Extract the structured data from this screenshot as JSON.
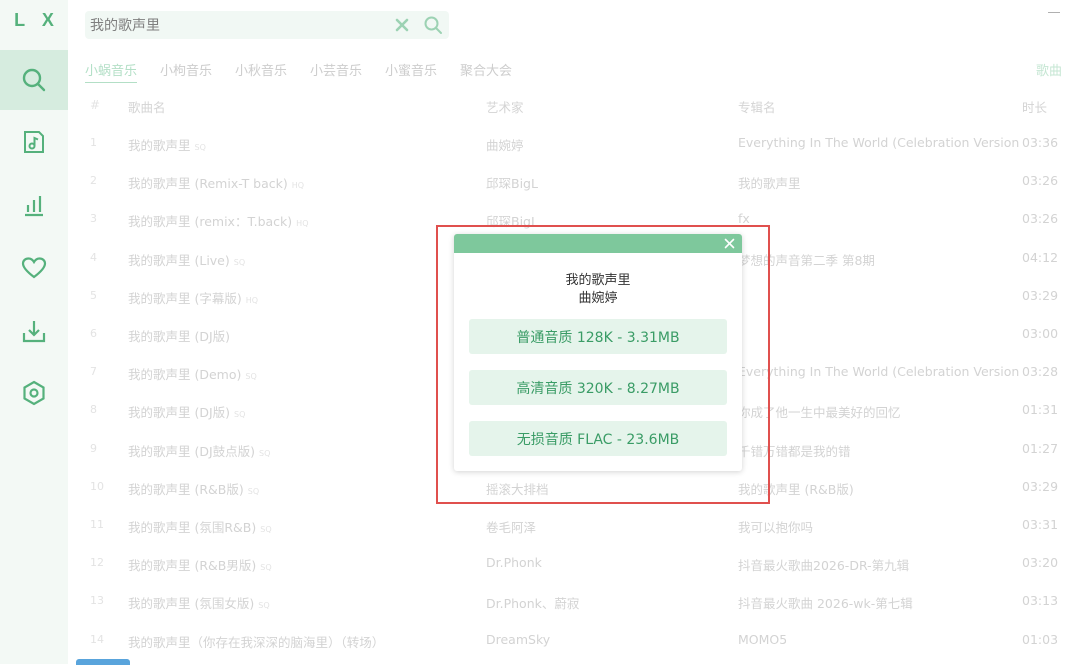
{
  "app": {
    "logo": "L X"
  },
  "sidebar": {
    "items": [
      {
        "icon": "search-icon"
      },
      {
        "icon": "music-file-icon"
      },
      {
        "icon": "bar-chart-icon"
      },
      {
        "icon": "heart-icon"
      },
      {
        "icon": "download-icon"
      },
      {
        "icon": "settings-hexagon-icon"
      }
    ]
  },
  "search": {
    "value": "我的歌声里"
  },
  "tabs": [
    {
      "label": "小蜗音乐",
      "active": true
    },
    {
      "label": "小枸音乐"
    },
    {
      "label": "小秋音乐"
    },
    {
      "label": "小芸音乐"
    },
    {
      "label": "小蜜音乐"
    },
    {
      "label": "聚合大会"
    }
  ],
  "tab_right": "歌曲",
  "table": {
    "headers": {
      "num": "#",
      "name": "歌曲名",
      "artist": "艺术家",
      "album": "专辑名",
      "duration": "时长"
    },
    "rows": [
      {
        "num": "1",
        "name": "我的歌声里",
        "badge": "SQ",
        "artist": "曲婉婷",
        "album": "Everything In The World (Celebration Version)",
        "duration": "03:36"
      },
      {
        "num": "2",
        "name": "我的歌声里 (Remix-T back)",
        "badge": "HQ",
        "artist": "邱琛BigL",
        "album": "我的歌声里",
        "duration": "03:26"
      },
      {
        "num": "3",
        "name": "我的歌声里 (remix：T.back)",
        "badge": "HQ",
        "artist": "邱琛BigL",
        "album": "fx",
        "duration": "03:26"
      },
      {
        "num": "4",
        "name": "我的歌声里 (Live)",
        "badge": "SQ",
        "artist": "",
        "album": "梦想的声音第二季 第8期",
        "duration": "04:12"
      },
      {
        "num": "5",
        "name": "我的歌声里 (字幕版)",
        "badge": "HQ",
        "artist": "",
        "album": "",
        "duration": "03:29"
      },
      {
        "num": "6",
        "name": "我的歌声里 (DJ版)",
        "badge": "",
        "artist": "",
        "album": "",
        "duration": "03:00"
      },
      {
        "num": "7",
        "name": "我的歌声里 (Demo)",
        "badge": "SQ",
        "artist": "",
        "album": "Everything In The World (Celebration Version)",
        "duration": "03:28"
      },
      {
        "num": "8",
        "name": "我的歌声里 (DJ版)",
        "badge": "SQ",
        "artist": "",
        "album": "你成了他一生中最美好的回忆",
        "duration": "01:31"
      },
      {
        "num": "9",
        "name": "我的歌声里 (DJ鼓点版)",
        "badge": "SQ",
        "artist": "",
        "album": "千错万错都是我的错",
        "duration": "01:27"
      },
      {
        "num": "10",
        "name": "我的歌声里 (R&B版)",
        "badge": "SQ",
        "artist": "摇滚大排档",
        "album": "我的歌声里 (R&B版)",
        "duration": "03:29"
      },
      {
        "num": "11",
        "name": "我的歌声里 (氛围R&B)",
        "badge": "SQ",
        "artist": "卷毛阿泽",
        "album": "我可以抱你吗",
        "duration": "03:31"
      },
      {
        "num": "12",
        "name": "我的歌声里 (R&B男版)",
        "badge": "SQ",
        "artist": "Dr.Phonk",
        "album": "抖音最火歌曲2026-DR-第九辑",
        "duration": "03:20"
      },
      {
        "num": "13",
        "name": "我的歌声里 (氛围女版)",
        "badge": "SQ",
        "artist": "Dr.Phonk、蔚寂",
        "album": "抖音最火歌曲 2026-wk-第七辑",
        "duration": "03:13"
      },
      {
        "num": "14",
        "name": "我的歌声里（你存在我深深的脑海里）（转场）",
        "badge": "",
        "artist": "DreamSky",
        "album": "MOMO5",
        "duration": "01:03"
      }
    ]
  },
  "modal": {
    "song_title": "我的歌声里",
    "artist": "曲婉婷",
    "options": [
      {
        "label": "普通音质 128K - 3.31MB"
      },
      {
        "label": "高清音质 320K - 8.27MB"
      },
      {
        "label": "无损音质 FLAC - 23.6MB"
      }
    ]
  },
  "colors": {
    "accent": "#55b17c",
    "highlight_border": "#e0504e"
  }
}
